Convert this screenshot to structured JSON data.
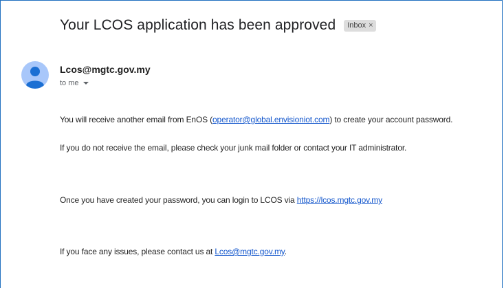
{
  "email": {
    "subject": "Your LCOS application has been approved",
    "label": "Inbox",
    "label_remove": "×",
    "sender": "Lcos@mgtc.gov.my",
    "recipient": "to me",
    "lines": {
      "l1_pre": "You will receive another email from EnOS (",
      "l1_link": "operator@global.envisioniot.com",
      "l1_post": ") to create your account password.",
      "l2": "If you do not receive the email, please check your junk mail folder or contact your IT administrator.",
      "l3_pre": "Once you have created your password, you can login to LCOS via ",
      "l3_link": "https://lcos.mgtc.gov.my",
      "l4_pre": "If you face any issues, please contact us at ",
      "l4_link": "Lcos@mgtc.gov.my",
      "l4_post": "."
    }
  },
  "icons": {
    "avatar": "default-person-icon",
    "recipient_dropdown": "caret-down-icon"
  },
  "colors": {
    "link": "#1155cc",
    "avatar_bg": "#a8c7fa",
    "avatar_figure": "#1b6fd3",
    "label_bg": "#dddddd",
    "frame_border": "#1f6fc0"
  }
}
